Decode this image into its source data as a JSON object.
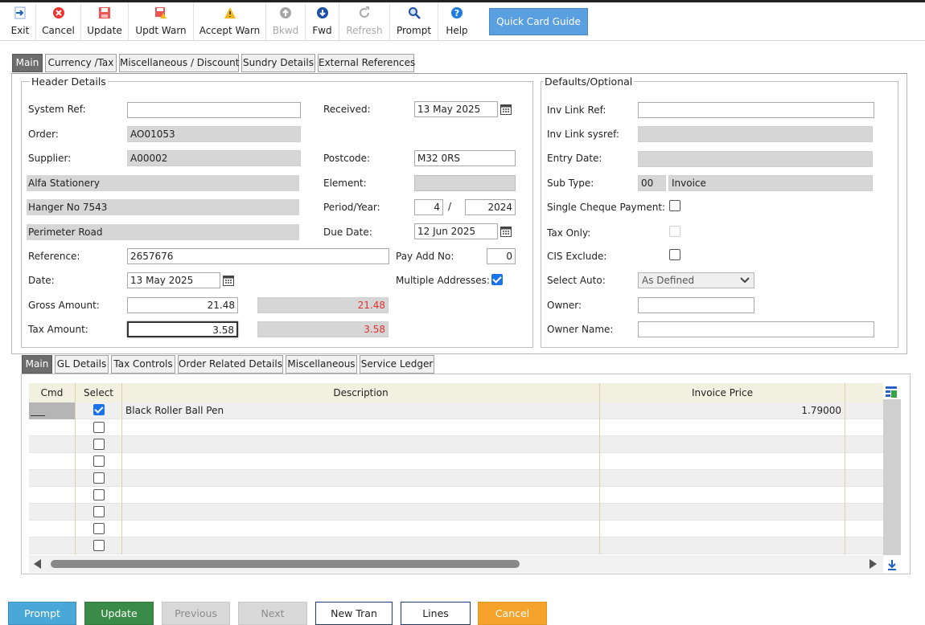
{
  "toolbar": {
    "exit": "Exit",
    "cancel": "Cancel",
    "update": "Update",
    "updt_warn": "Updt Warn",
    "accept_warn": "Accept Warn",
    "bkwd": "Bkwd",
    "fwd": "Fwd",
    "refresh": "Refresh",
    "prompt": "Prompt",
    "help": "Help",
    "quick_card_guide": "Quick Card Guide"
  },
  "top_tabs": [
    "Main",
    "Currency /Tax",
    "Miscellaneous / Discount",
    "Sundry Details",
    "External References"
  ],
  "header": {
    "legend": "Header Details",
    "system_ref_label": "System Ref:",
    "system_ref": "",
    "order_label": "Order:",
    "order": "AO01053",
    "supplier_label": "Supplier:",
    "supplier": "A00002",
    "address1": "Alfa Stationery",
    "address2": "Hanger No 7543",
    "address3": "Perimeter Road",
    "reference_label": "Reference:",
    "reference": "2657676",
    "date_label": "Date:",
    "date": "13 May 2025",
    "gross_label": "Gross Amount:",
    "gross": "21.48",
    "gross_ro": "21.48",
    "tax_label": "Tax Amount:",
    "tax": "3.58",
    "tax_ro": "3.58",
    "received_label": "Received:",
    "received": "13 May 2025",
    "postcode_label": "Postcode:",
    "postcode": "M32 0RS",
    "element_label": "Element:",
    "element": "",
    "period_label": "Period/Year:",
    "period": "4",
    "period_sep": "/",
    "year": "2024",
    "due_label": "Due Date:",
    "due": "12 Jun 2025",
    "payadd_label": "Pay Add No:",
    "payadd": "0",
    "multiaddr_label": "Multiple Addresses:"
  },
  "defaults": {
    "legend": "Defaults/Optional",
    "inv_link_ref_label": "Inv Link Ref:",
    "inv_link_sysref_label": "Inv Link sysref:",
    "entry_date_label": "Entry Date:",
    "sub_type_label": "Sub Type:",
    "sub_type_code": "00",
    "sub_type_name": "Invoice",
    "single_cheque_label": "Single Cheque Payment:",
    "tax_only_label": "Tax Only:",
    "cis_label": "CIS Exclude:",
    "select_auto_label": "Select Auto:",
    "select_auto": "As Defined",
    "owner_label": "Owner:",
    "owner_name_label": "Owner Name:"
  },
  "lower_tabs": [
    "Main",
    "GL Details",
    "Tax Controls",
    "Order Related Details",
    "Miscellaneous",
    "Service Ledger"
  ],
  "grid": {
    "headers": [
      "Cmd",
      "Select",
      "Description",
      "Invoice Price"
    ],
    "row1": {
      "cmd": "___",
      "description": "Black Roller Ball Pen",
      "price": "1.79000"
    }
  },
  "bottom": {
    "prompt": "Prompt",
    "update": "Update",
    "previous": "Previous",
    "next": "Next",
    "new_tran": "New Tran",
    "lines": "Lines",
    "cancel": "Cancel"
  },
  "colors": {
    "accent": "#5a9fe0",
    "update_green": "#3a8a48",
    "prompt_blue": "#4aa8d8",
    "cancel_orange": "#f5a32a",
    "negative_red": "#e03030"
  }
}
